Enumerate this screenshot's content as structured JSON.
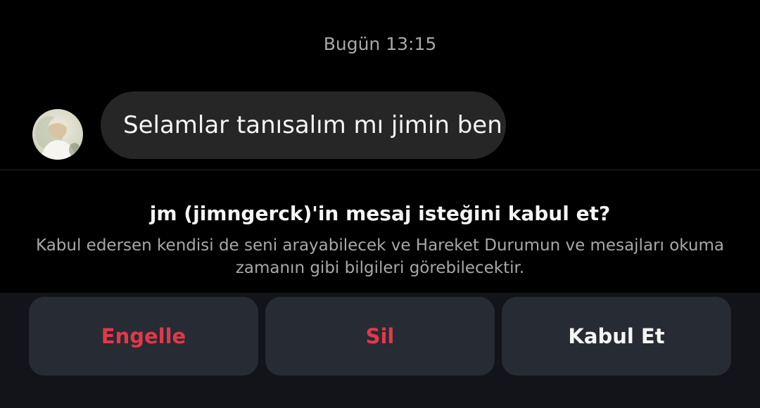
{
  "chat": {
    "timestamp": "Bugün 13:15",
    "message": {
      "text": "Selamlar tanısalım mı jimin ben",
      "sender_avatar_icon": "user-avatar"
    }
  },
  "request": {
    "title": "jm (jimngerck)'in mesaj isteğini kabul et?",
    "description": "Kabul edersen kendisi de seni arayabilecek ve Hareket Durumun ve mesajları okuma zamanın gibi bilgileri görebilecektir."
  },
  "actions": {
    "block_label": "Engelle",
    "delete_label": "Sil",
    "accept_label": "Kabul Et"
  },
  "colors": {
    "background": "#000000",
    "bubble": "#262626",
    "danger": "#e0394b",
    "button_bg": "#272b33",
    "action_bar_bg": "#121419"
  }
}
